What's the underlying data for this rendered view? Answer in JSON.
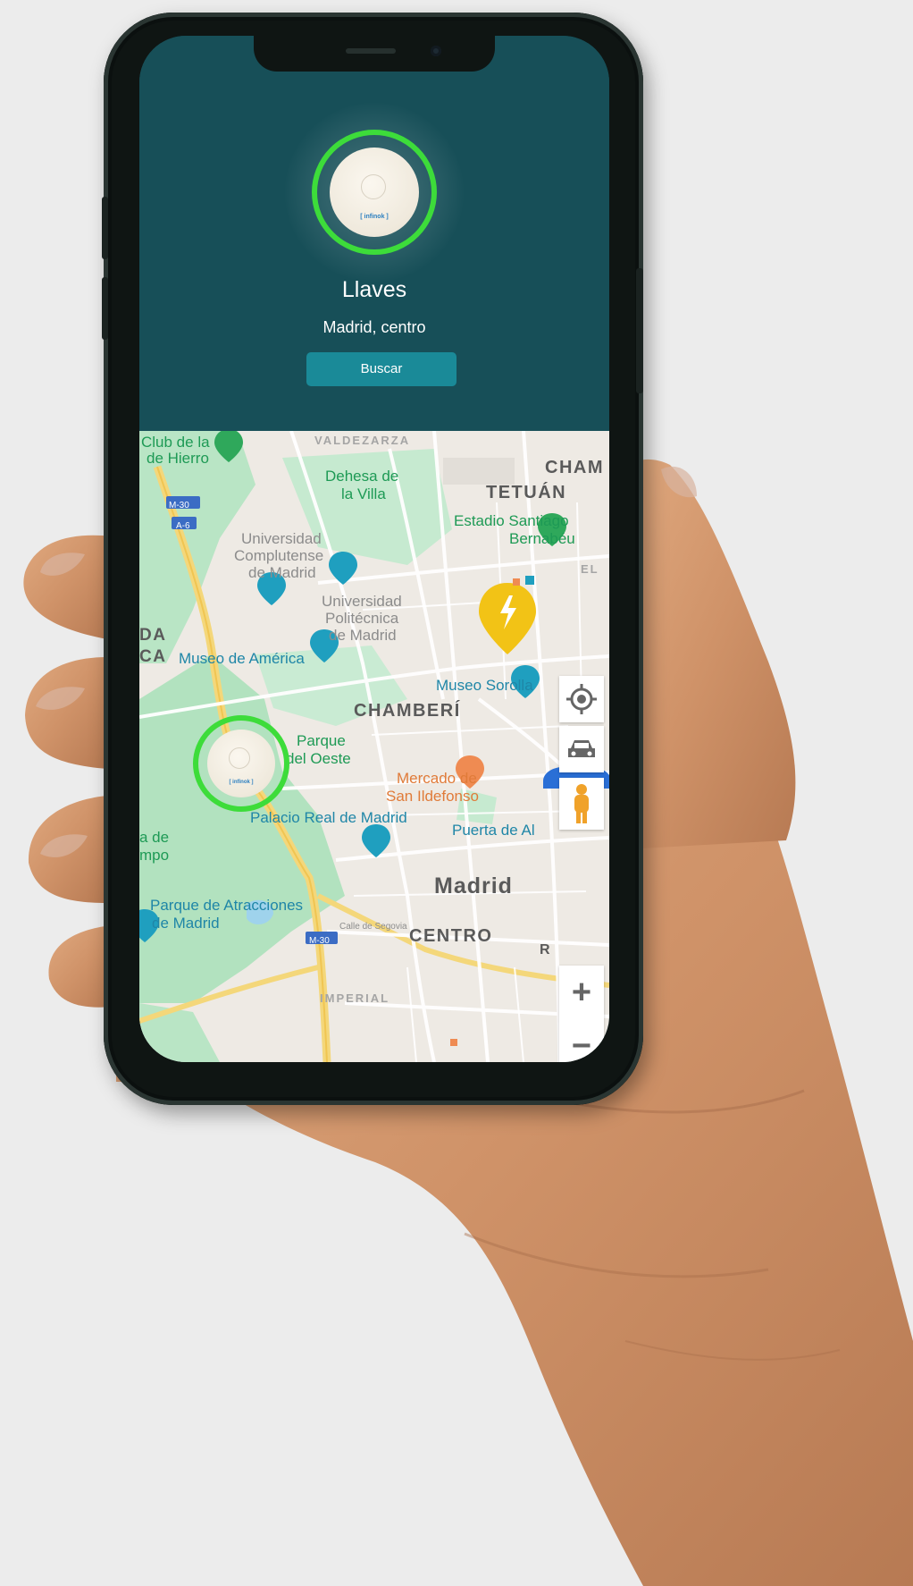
{
  "app": {
    "item_title": "Llaves",
    "location_text": "Madrid, centro",
    "search_button_label": "Buscar",
    "tag_brand": "[ infinok ]"
  },
  "map": {
    "labels": {
      "club_hierro": "Club de la",
      "club_hierro_2": "de Hierro",
      "valdezarza": "VALDEZARZA",
      "dehesa": "Dehesa de",
      "dehesa_2": "la Villa",
      "chamartin": "CHAM",
      "tetuan": "TETUÁN",
      "estadio": "Estadio Santiago",
      "estadio_2": "Bernabéu",
      "ucm": "Universidad",
      "ucm_2": "Complutense",
      "ucm_3": "de Madrid",
      "upm": "Universidad",
      "upm_2": "Politécnica",
      "upm_3": "de Madrid",
      "el": "EL",
      "da": "DA",
      "ca": "CA",
      "museo_america": "Museo de América",
      "museo_sorolla": "Museo Sorolla",
      "chamberi": "CHAMBERÍ",
      "parque_oeste": "Parque",
      "parque_oeste_2": "del Oeste",
      "mercado": "Mercado de",
      "mercado_2": "San Ildefonso",
      "palacio": "Palacio Real de Madrid",
      "puerta": "Puerta de Al",
      "campo": "a de",
      "campo_2": "mpo",
      "madrid": "Madrid",
      "parque_atracciones": "Parque de Atracciones",
      "parque_atracciones_2": "de Madrid",
      "centro": "CENTRO",
      "imperial": "IMPERIAL",
      "m30_top": "M-30",
      "a6": "A-6",
      "m30_bottom": "M-30",
      "calle_segovia": "Calle de Segovia",
      "r": "R"
    },
    "controls": {
      "zoom_in": "+",
      "zoom_out": "−"
    }
  },
  "colors": {
    "header_bg": "#174f58",
    "search_button": "#1a8a98",
    "tag_ring": "#3ddc3a",
    "park_green": "#b9e5c5",
    "marker_yellow": "#f2c316"
  }
}
